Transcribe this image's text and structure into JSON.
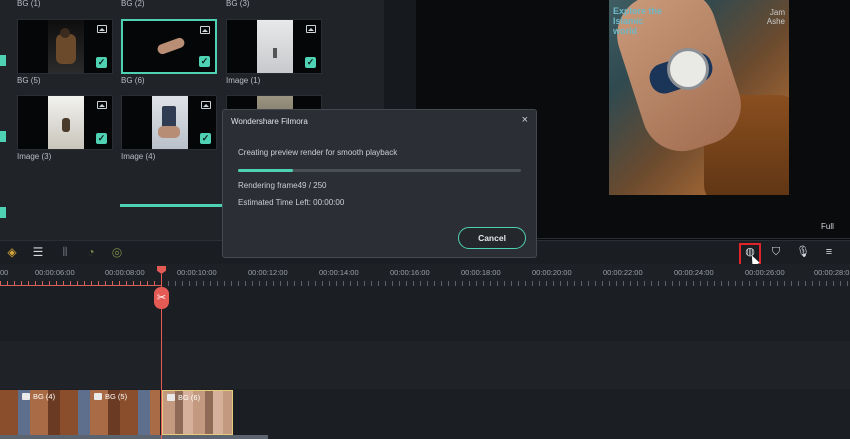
{
  "media": {
    "top_labels": [
      "BG (1)",
      "BG (2)",
      "BG (3)"
    ],
    "row1": [
      {
        "label": "BG (5)",
        "selected": false
      },
      {
        "label": "BG (6)",
        "selected": true
      },
      {
        "label": "Image (1)",
        "selected": false
      }
    ],
    "row2": [
      {
        "label": "Image (3)",
        "selected": false
      },
      {
        "label": "Image (4)",
        "selected": false
      }
    ]
  },
  "preview": {
    "sign_text": "Explore the Islamic world",
    "sign_text2": "Jam Ashe",
    "progress": 0.8,
    "full_label": "Full"
  },
  "toolbar": {
    "left_icons": [
      "keyframe-icon",
      "adjust-icon",
      "audio-mixer-icon",
      "speed-icon",
      "stabilize-icon"
    ],
    "right_icons": [
      "render-preview-icon",
      "marker-icon",
      "microphone-icon",
      "voiceover-list-icon"
    ]
  },
  "ruler": {
    "ticks": [
      "00",
      "00:00:06:00",
      "00:00:08:00",
      "00:00:10:00",
      "00:00:12:00",
      "00:00:14:00",
      "00:00:16:00",
      "00:00:18:00",
      "00:00:20:00",
      "00:00:22:00",
      "00:00:24:00",
      "00:00:26:00",
      "00:00:28:0"
    ]
  },
  "timeline": {
    "clip_a_labels": [
      "BG (4)",
      "BG (5)"
    ],
    "clip_b_label": "BG (6)"
  },
  "dialog": {
    "title": "Wondershare Filmora",
    "close": "×",
    "message": "Creating preview render for smooth playback",
    "progress": 0.196,
    "frame_text": "Rendering frame49 / 250",
    "time_text": "Estimated Time Left: 00:00:00",
    "cancel_label": "Cancel"
  },
  "colors": {
    "accent": "#4fd1b4",
    "playhead": "#e45a55",
    "highlight_box": "#e0242a",
    "toolbar_icon": "#d4a53a"
  }
}
